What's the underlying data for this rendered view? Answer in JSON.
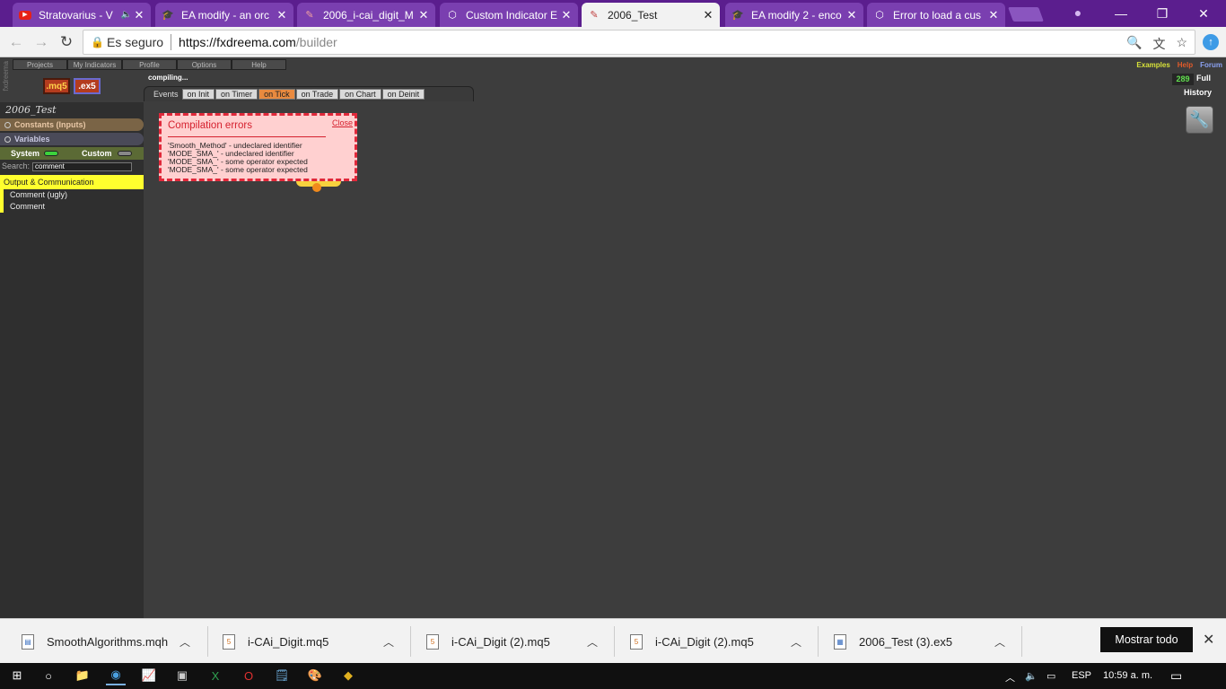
{
  "browser": {
    "tabs": [
      {
        "title": "Stratovarius - V",
        "icon": "youtube-icon",
        "color": "#e62117",
        "active": false
      },
      {
        "title": "EA modify - an orc",
        "icon": "graduation-cap-icon",
        "color": "#3c6fbf",
        "active": false
      },
      {
        "title": "2006_i-cai_digit_M",
        "icon": "fxdreema-icon",
        "color": "#c04040",
        "active": false
      },
      {
        "title": "Custom Indicator E",
        "icon": "hexagon-icon",
        "color": "#555",
        "active": false
      },
      {
        "title": "2006_Test",
        "icon": "fxdreema-icon",
        "color": "#c04040",
        "active": true
      },
      {
        "title": "EA modify 2 - enco",
        "icon": "graduation-cap-icon",
        "color": "#3c6fbf",
        "active": false
      },
      {
        "title": "Error to load a cus",
        "icon": "hexagon-icon",
        "color": "#555",
        "active": false
      }
    ],
    "secure_label": "Es seguro",
    "url_host": "https://fxdreema.com",
    "url_path": "/builder"
  },
  "app": {
    "top_menu": [
      "Projects",
      "My Indicators",
      "Profile",
      "Options",
      "Help"
    ],
    "side_brand": "fxdreema",
    "mq5_label": ".mq5",
    "ex5_label": ".ex5",
    "status": "compiling...",
    "links": {
      "examples": "Examples",
      "help": "Help",
      "forum": "Forum"
    },
    "counter": "289",
    "full_label": "Full",
    "history_label": "History",
    "events_label": "Events",
    "events": [
      "on Init",
      "on Timer",
      "on Tick",
      "on Trade",
      "on Chart",
      "on Deinit"
    ],
    "active_event": "on Tick"
  },
  "sidebar": {
    "project_name": "2006_Test",
    "constants_label": "Constants (Inputs)",
    "variables_label": "Variables",
    "system_label": "System",
    "custom_label": "Custom",
    "search_label": "Search:",
    "search_value": "comment",
    "category": "Output & Communication",
    "items": [
      "Comment (ugly)",
      "Comment"
    ]
  },
  "error_popup": {
    "title": "Compilation errors",
    "close_label": "Close",
    "lines": [
      "'Smooth_Method' - undeclared identifier",
      "'MODE_SMA_' - undeclared identifier",
      "'MODE_SMA_' - some operator expected",
      "'MODE_SMA_' - some operator expected"
    ]
  },
  "downloads": {
    "files": [
      {
        "name": "SmoothAlgorithms.mqh",
        "icon": "file-icon"
      },
      {
        "name": "i-CAi_Digit.mq5",
        "icon": "mq5-file-icon"
      },
      {
        "name": "i-CAi_Digit (2).mq5",
        "icon": "mq5-file-icon"
      },
      {
        "name": "i-CAi_Digit (2).mq5",
        "icon": "mq5-file-icon"
      },
      {
        "name": "2006_Test (3).ex5",
        "icon": "ex5-file-icon"
      }
    ],
    "show_all_label": "Mostrar todo"
  },
  "taskbar": {
    "lang": "ESP",
    "time": "10:59 a. m."
  }
}
